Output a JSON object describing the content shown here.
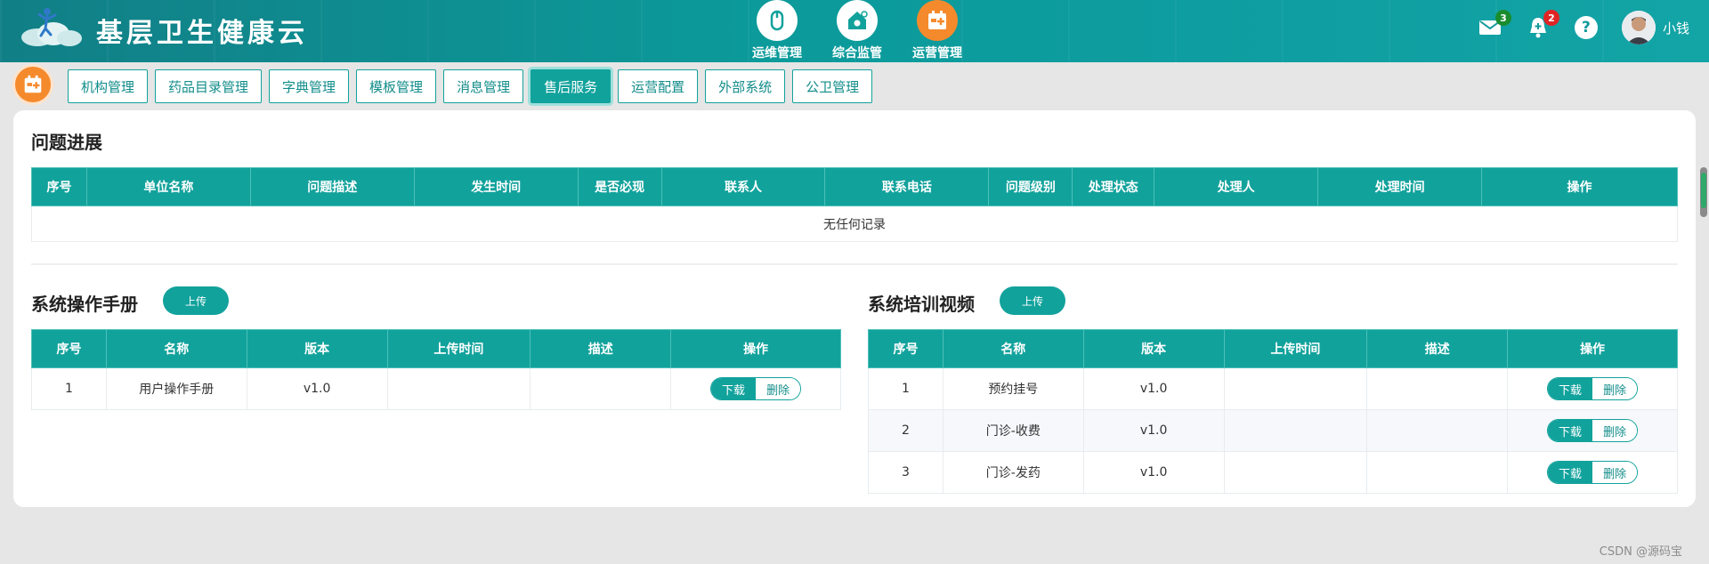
{
  "app": {
    "title": "基层卫生健康云"
  },
  "topnav": [
    {
      "label": "运维管理",
      "icon": "mouse-icon"
    },
    {
      "label": "综合监管",
      "icon": "house-search-icon"
    },
    {
      "label": "运营管理",
      "icon": "calendar-plus-icon"
    }
  ],
  "header_tools": {
    "mail_count": "3",
    "notify_count": "2",
    "help": "?",
    "user_name": "小钱"
  },
  "subnav": {
    "tabs": [
      "机构管理",
      "药品目录管理",
      "字典管理",
      "模板管理",
      "消息管理",
      "售后服务",
      "运营配置",
      "外部系统",
      "公卫管理"
    ],
    "active": "售后服务"
  },
  "progress": {
    "title": "问题进展",
    "columns": [
      "序号",
      "单位名称",
      "问题描述",
      "发生时间",
      "是否必现",
      "联系人",
      "联系电话",
      "问题级别",
      "处理状态",
      "处理人",
      "处理时间",
      "操作"
    ],
    "empty_text": "无任何记录"
  },
  "manual": {
    "title": "系统操作手册",
    "upload_label": "上传",
    "columns": [
      "序号",
      "名称",
      "版本",
      "上传时间",
      "描述",
      "操作"
    ],
    "rows": [
      {
        "no": "1",
        "name": "用户操作手册",
        "version": "v1.0",
        "time": "",
        "desc": ""
      }
    ],
    "download_label": "下载",
    "delete_label": "删除"
  },
  "video": {
    "title": "系统培训视频",
    "upload_label": "上传",
    "columns": [
      "序号",
      "名称",
      "版本",
      "上传时间",
      "描述",
      "操作"
    ],
    "rows": [
      {
        "no": "1",
        "name": "预约挂号",
        "version": "v1.0",
        "time": "",
        "desc": ""
      },
      {
        "no": "2",
        "name": "门诊-收费",
        "version": "v1.0",
        "time": "",
        "desc": ""
      },
      {
        "no": "3",
        "name": "门诊-发药",
        "version": "v1.0",
        "time": "",
        "desc": ""
      }
    ],
    "download_label": "下载",
    "delete_label": "删除"
  },
  "watermark": "CSDN @源码宝",
  "colors": {
    "primary": "#12a29c",
    "accent": "#f58a2c",
    "header": "#0c9a9a"
  }
}
